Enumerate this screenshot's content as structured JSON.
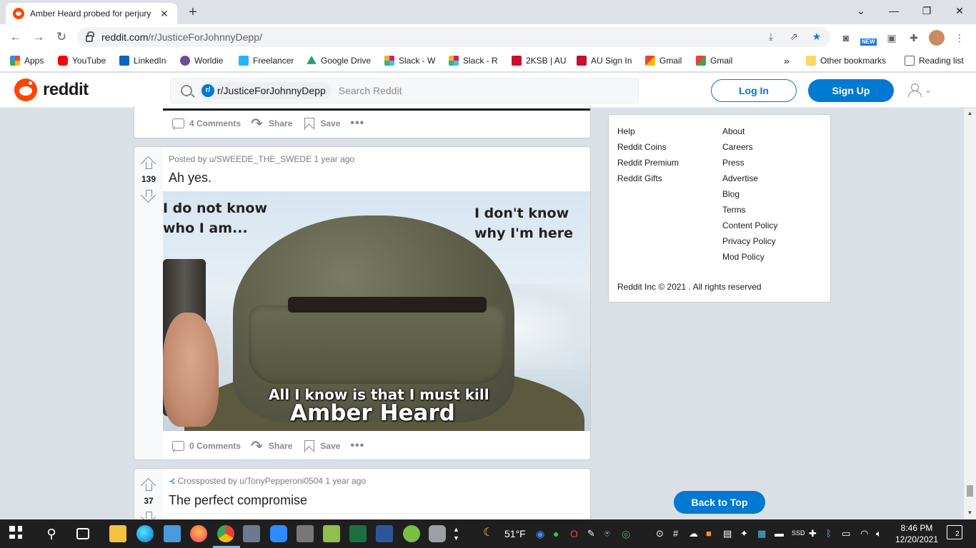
{
  "browser": {
    "tab_title": "Amber Heard probed for perjury",
    "url_domain": "reddit.com",
    "url_path": "/r/JusticeForJohnnyDepp/",
    "new_badge": "NEW"
  },
  "bookmarks": [
    {
      "label": "Apps",
      "icon": "apps-grid-icon",
      "color": "#ea4335"
    },
    {
      "label": "YouTube",
      "icon": "youtube-icon",
      "color": "#ff0000"
    },
    {
      "label": "LinkedIn",
      "icon": "linkedin-icon",
      "color": "#0a66c2"
    },
    {
      "label": "Worldie",
      "icon": "worldie-icon",
      "color": "#6d4c9a"
    },
    {
      "label": "Freelancer",
      "icon": "freelancer-icon",
      "color": "#29b2fe"
    },
    {
      "label": "Google Drive",
      "icon": "google-drive-icon",
      "color": "#1fa463"
    },
    {
      "label": "Slack - W",
      "icon": "slack-icon",
      "color": "#e01e5a"
    },
    {
      "label": "Slack - R",
      "icon": "slack-icon",
      "color": "#36c5f0"
    },
    {
      "label": "2KSB | AU",
      "icon": "au-icon",
      "color": "#c8102e"
    },
    {
      "label": "AU Sign In",
      "icon": "au-icon",
      "color": "#c8102e"
    },
    {
      "label": "Gmail",
      "icon": "gmail-icon",
      "color": "#ea4335"
    },
    {
      "label": "Gmail",
      "icon": "gmail-icon",
      "color": "#ea4335"
    }
  ],
  "bookmarks_overflow": "»",
  "other_bookmarks": "Other bookmarks",
  "reading_list": "Reading list",
  "reddit": {
    "wordmark": "reddit",
    "search_chip": "r/JusticeForJohnnyDepp",
    "search_placeholder": "Search Reddit",
    "login_label": "Log In",
    "signup_label": "Sign Up",
    "accent": "#0079d3",
    "brand": "#ff4500"
  },
  "prev_post": {
    "comments": "4 Comments",
    "share": "Share",
    "save": "Save",
    "more": "•••"
  },
  "post1": {
    "score": "139",
    "meta": "Posted by u/SWEEDE_THE_SWEDE 1 year ago",
    "title": "Ah yes.",
    "meme_top_left": [
      "I do not know",
      "who I am..."
    ],
    "meme_top_right": [
      "I don't know",
      "why I'm here"
    ],
    "meme_bottom_1": "All I know is that I must kill",
    "meme_bottom_2": "Amber Heard",
    "comments": "0 Comments",
    "share": "Share",
    "save": "Save",
    "more": "•••"
  },
  "post2": {
    "score": "37",
    "meta": "Crossposted by u/TonyPepperoni0504 1 year ago",
    "title": "The perfect compromise"
  },
  "sidebar": {
    "col1": [
      "Help",
      "Reddit Coins",
      "Reddit Premium",
      "Reddit Gifts"
    ],
    "col2": [
      "About",
      "Careers",
      "Press",
      "Advertise",
      "Blog",
      "Terms",
      "Content Policy",
      "Privacy Policy",
      "Mod Policy"
    ],
    "copyright": "Reddit Inc © 2021 . All rights reserved"
  },
  "back_to_top": "Back to Top",
  "taskbar": {
    "weather": "51°F",
    "time": "8:46 PM",
    "date": "12/20/2021",
    "notifications": "2"
  }
}
